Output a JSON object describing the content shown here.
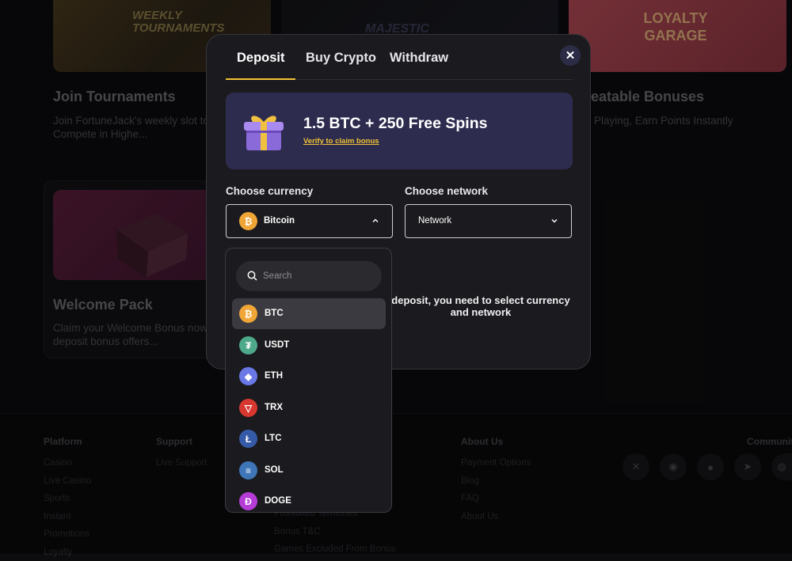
{
  "background": {
    "cards": [
      {
        "title": "Join Tournaments",
        "desc1": "Join FortuneJack's weekly slot to",
        "desc2": "Compete in Highe..."
      },
      {
        "title": "peatable Bonuses",
        "desc1": "Playing, Earn Points Instantly",
        "desc2": ""
      },
      {
        "title": "Welcome Pack",
        "desc1": "Claim your Welcome Bonus now",
        "desc2": "deposit bonus offers..."
      }
    ],
    "banner_texts": {
      "tournaments": "WEEKLY TOURNAMENTS",
      "majestic": "MAJESTIC",
      "loyalty": "LOYALTY GARAGE"
    }
  },
  "footer": {
    "platform": {
      "heading": "Platform",
      "links": [
        "Casino",
        "Live Casino",
        "Sports",
        "Instant",
        "Promotions",
        "Loyalty"
      ]
    },
    "support": {
      "heading": "Support",
      "links": [
        "Live Support"
      ]
    },
    "middle": {
      "links": [
        "Prohibited Territories",
        "Bonus T&C",
        "Games Excluded From Bonus"
      ]
    },
    "about": {
      "heading": "About Us",
      "links": [
        "Payment Options",
        "Blog",
        "FAQ",
        "About Us"
      ]
    },
    "community": {
      "heading": "Communit"
    }
  },
  "modal": {
    "tabs": [
      "Deposit",
      "Buy Crypto",
      "Withdraw"
    ],
    "active_tab": "Deposit",
    "bonus": {
      "title": "1.5 BTC + 250 Free Spins",
      "link": "Verify to claim bonus"
    },
    "currency_label": "Choose currency",
    "network_label": "Choose network",
    "currency_value": "Bitcoin",
    "network_value": "Network",
    "info_line1": "deposit, you need to select currency",
    "info_line2": "and network"
  },
  "dropdown": {
    "search_placeholder": "Search",
    "items": [
      {
        "label": "BTC",
        "icon": "bitcoin-icon",
        "color": "#f0a537"
      },
      {
        "label": "USDT",
        "icon": "tether-icon",
        "color": "#4ea98a"
      },
      {
        "label": "ETH",
        "icon": "ethereum-icon",
        "color": "#6a78e6"
      },
      {
        "label": "TRX",
        "icon": "tron-icon",
        "color": "#d8372f"
      },
      {
        "label": "LTC",
        "icon": "litecoin-icon",
        "color": "#355ba8"
      },
      {
        "label": "SOL",
        "icon": "solana-icon",
        "color": "#3e76b8"
      },
      {
        "label": "DOGE",
        "icon": "doge-icon",
        "color": "#b63cd8"
      }
    ],
    "selected": "BTC"
  },
  "colors": {
    "accent": "#f1c232",
    "modal_bg": "#1b1b1f",
    "bonus_bg": "#2d2c4f"
  }
}
